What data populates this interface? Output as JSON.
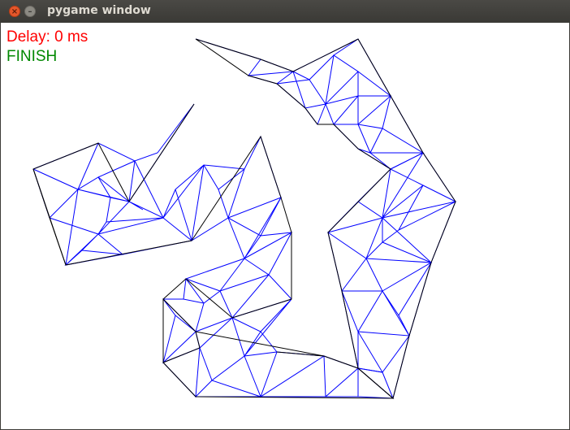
{
  "window": {
    "title": "pygame window",
    "close_symbol": "×",
    "minimize_symbol": "–"
  },
  "status": {
    "delay_text": "Delay: 0 ms",
    "state_text": "FINISH"
  },
  "colors": {
    "outline": "#000000",
    "triangulation": "#0000ff",
    "delay": "#ff0000",
    "finish": "#008800",
    "background": "#ffffff"
  }
}
